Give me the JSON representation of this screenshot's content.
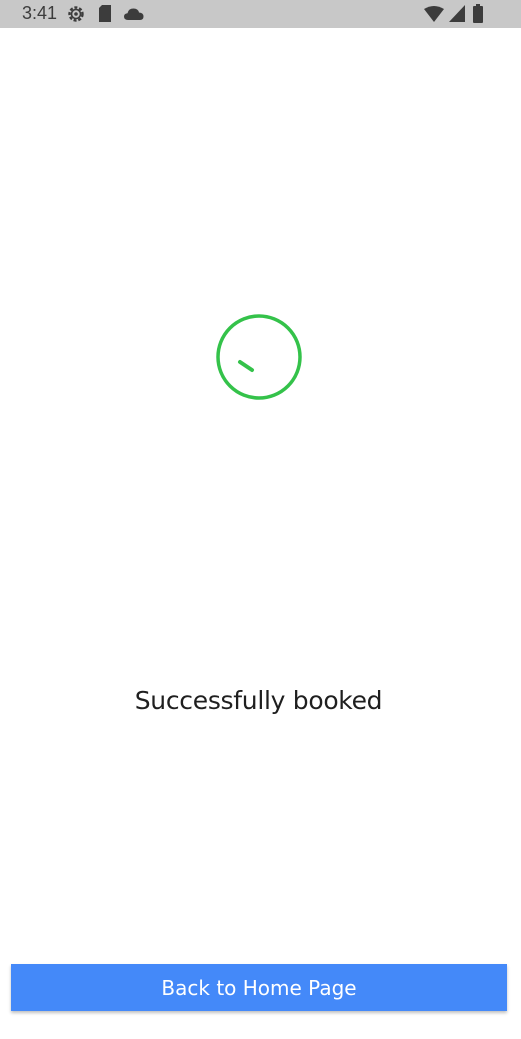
{
  "status_bar": {
    "time": "3:41",
    "icons": [
      "settings-icon",
      "sd-card-icon",
      "cloud-icon",
      "wifi-icon",
      "signal-icon",
      "battery-icon"
    ]
  },
  "main": {
    "success_icon": "check-circle-icon",
    "accent_color": "#34c24a",
    "message": "Successfully booked"
  },
  "footer": {
    "button_label": "Back to Home Page",
    "button_color": "#4489f9"
  }
}
